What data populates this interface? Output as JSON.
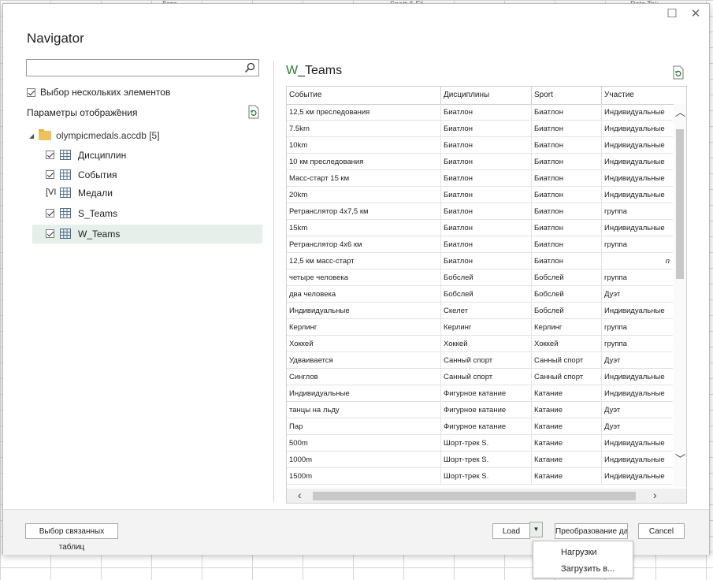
{
  "background": {
    "headers": [
      "Дата",
      "Sport & Fil",
      "Date Tou"
    ]
  },
  "dialog": {
    "title": "Navigator",
    "search": {
      "placeholder": "",
      "value": ""
    },
    "multi_select_label": "Выбор нескольких элементов",
    "display_options_label": "Параметры отображ̃ения",
    "tree": {
      "root_label": "olympicmedals.accdb [5]",
      "items": [
        {
          "label": "Дисциплин",
          "checked": true
        },
        {
          "label": "События",
          "checked": true
        },
        {
          "label": "Медали",
          "checked": "partial",
          "prefix": "[VI"
        },
        {
          "label": "S_Teams",
          "checked": true
        },
        {
          "label": "W_Teams",
          "checked": true,
          "selected": true
        }
      ]
    },
    "preview": {
      "title_prefix": "W",
      "title_rest": "_Teams",
      "columns": [
        "Событие",
        "Дисциплины",
        "Sport",
        "Участие"
      ],
      "rows": [
        [
          "12,5 км преследования",
          "Биатлон",
          "Биатлон",
          "Индивидуальные"
        ],
        [
          "7.5km",
          "Биатлон",
          "Биатлон",
          "Индивидуальные"
        ],
        [
          "10km",
          "Биатлон",
          "Биатлон",
          "Индивидуальные"
        ],
        [
          "10 км преследования",
          "Биатлон",
          "Биатлон",
          "Индивидуальные"
        ],
        [
          "Масс-старт 15 км",
          "Биатлон",
          "Биатлон",
          "Индивидуальные"
        ],
        [
          "20km",
          "Биатлон",
          "Биатлон",
          "Индивидуальные"
        ],
        [
          "Ретранслятор 4x7,5 км",
          "Биатлон",
          "Биатлон",
          "группа"
        ],
        [
          "15km",
          "Биатлон",
          "Биатлон",
          "Индивидуальные"
        ],
        [
          "Ретранслятор 4x6 км",
          "Биатлон",
          "Биатлон",
          "группа"
        ],
        [
          "12,5 км масс-старт",
          "Биатлон",
          "Биатлон",
          "n"
        ],
        [
          "четыре человека",
          "Бобслей",
          "Бобслей",
          "группа"
        ],
        [
          "два человека",
          "Бобслей",
          "Бобслей",
          "Дуэт"
        ],
        [
          "Индивидуальные",
          "Скелет",
          "Бобслей",
          "Индивидуальные"
        ],
        [
          "Керлинг",
          "Керлинг",
          "Керлинг",
          "группа"
        ],
        [
          "Хоккей",
          "Хоккей",
          "Хоккей",
          "группа"
        ],
        [
          "Удваивается",
          "Санный спорт",
          "Санный спорт",
          "Дуэт"
        ],
        [
          "Синглов",
          "Санный спорт",
          "Санный спорт",
          "Индивидуальные"
        ],
        [
          "Индивидуальные",
          "Фигурное катание",
          "Катание",
          "Индивидуальные"
        ],
        [
          "танцы на льду",
          "Фигурное катание",
          "Катание",
          "Дуэт"
        ],
        [
          "Пар",
          "Фигурное катание",
          "Катание",
          "Дуэт"
        ],
        [
          "500m",
          "Шорт-трек S.",
          "Катание",
          "Индивидуальные"
        ],
        [
          "1000m",
          "Шорт-трек S.",
          "Катание",
          "Индивидуальные"
        ],
        [
          "1500m",
          "Шорт-трек S.",
          "Катание",
          "Индивидуальные"
        ]
      ]
    },
    "footer": {
      "related_tables_label": "Выбор связанных таблиц",
      "load_label": "Load",
      "transform_label": "Преобразование данных",
      "cancel_label": "Cancel"
    },
    "load_menu": {
      "items": [
        "Нагрузки",
        "Загрузить в..."
      ]
    }
  },
  "icons": {
    "search": "search-icon",
    "refresh": "refresh-icon",
    "folder": "folder-icon",
    "table": "table-icon",
    "maximize": "maximize-icon",
    "close": "close-icon"
  },
  "colors": {
    "selection": "#e6efea",
    "title_accent": "#2e7d32",
    "folder": "#f0c35a"
  }
}
